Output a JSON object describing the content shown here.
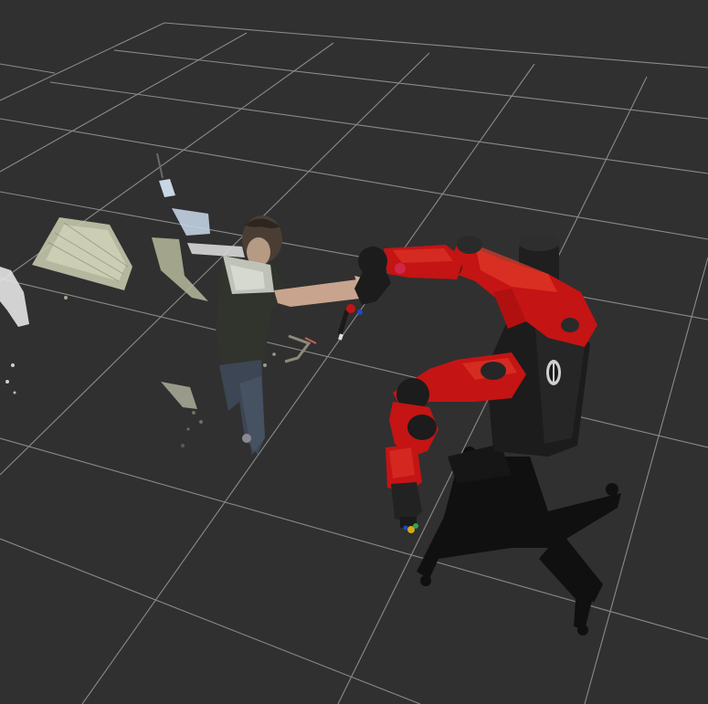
{
  "viewport": {
    "background": "#303030",
    "grid_color": "#a0a0a0"
  },
  "scene": {
    "grid": "grid-plane",
    "point_cloud": "rgbd-point-cloud",
    "robot": "red-dual-arm-robot-model",
    "robot_colors": {
      "body": "#c41414",
      "body_highlight": "#e23a2a",
      "joints": "#2a2a2a",
      "torso": "#1e1e1e",
      "pedestal": "#0f0f0f"
    }
  }
}
